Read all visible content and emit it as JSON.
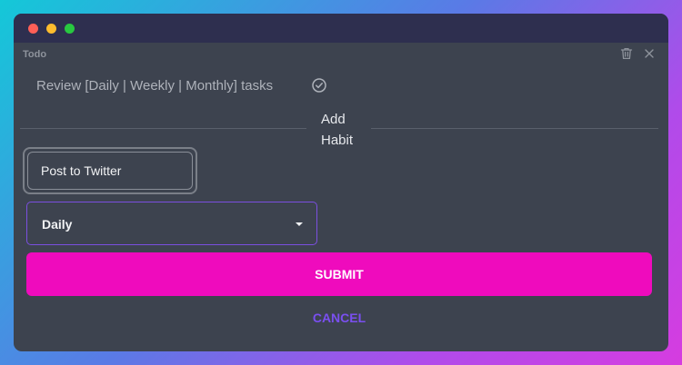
{
  "app": {
    "title": "Todo"
  },
  "task": {
    "text": "Review [Daily | Weekly | Monthly] tasks"
  },
  "section": {
    "add_habit_label": "Add Habit"
  },
  "form": {
    "habit_value": "Post to Twitter",
    "frequency_selected": "Daily",
    "submit_label": "SUBMIT",
    "cancel_label": "CANCEL"
  },
  "icons": {
    "trash": "trash-icon",
    "close": "close-icon",
    "check": "check-circle-icon",
    "caret": "chevron-down-icon"
  },
  "colors": {
    "accent_submit": "#ef0bbd",
    "accent_cancel": "#7a4ff0",
    "select_border": "#7b4fe0",
    "window_bg": "#3d434f"
  }
}
